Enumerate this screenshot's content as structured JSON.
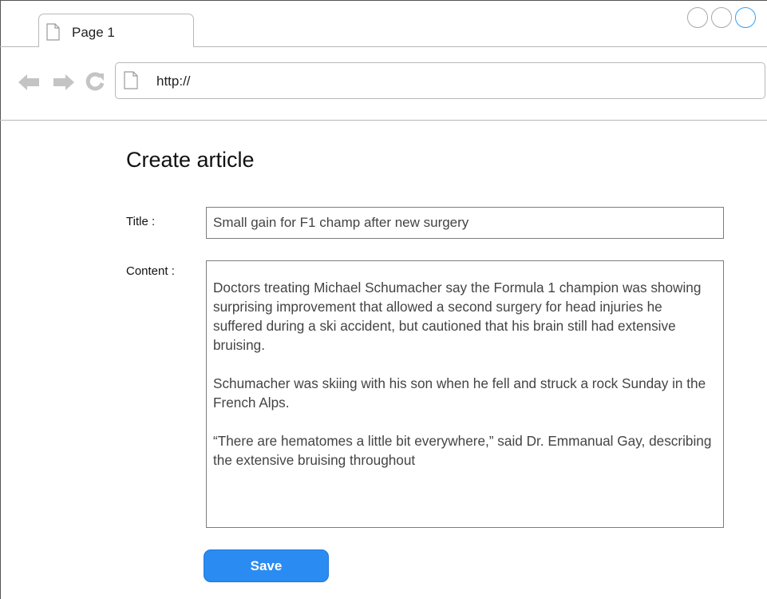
{
  "browser": {
    "tab": {
      "title": "Page 1",
      "icon": "page-icon"
    },
    "address_bar": {
      "value": "http://",
      "icon": "page-icon"
    },
    "nav_icons": [
      "back-arrow-icon",
      "forward-arrow-icon",
      "reload-icon"
    ],
    "window_controls": [
      "window-button",
      "window-button",
      "window-button"
    ],
    "accent_color": "#3aa0ef"
  },
  "form": {
    "heading": "Create article",
    "title_label": "Title :",
    "title_value": "Small gain for F1 champ after new surgery",
    "content_label": "Content :",
    "content_paragraphs": [
      "Doctors treating Michael Schumacher say the Formula 1 champion was showing surprising improvement that allowed a second surgery for head injuries he suffered during a ski accident, but cautioned that his brain still had extensive bruising.",
      "Schumacher was skiing with his son when he fell and struck a rock Sunday in the French Alps.",
      "“There are hematomes a little bit everywhere,” said Dr. Emmanual Gay, describing the extensive bruising throughout"
    ],
    "save_label": "Save",
    "save_color": "#2a8cf2"
  }
}
